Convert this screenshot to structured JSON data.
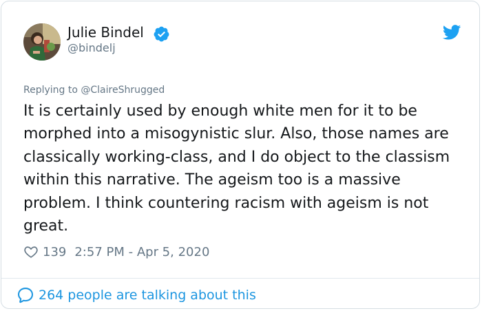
{
  "author": {
    "name": "Julie Bindel",
    "handle": "@bindelj",
    "verified": true,
    "avatar": "profile-photo"
  },
  "tweet": {
    "replying_to": "Replying to @ClaireShrugged",
    "text": "It is certainly used by enough white men for it to be morphed into a misogynistic slur. Also, those names are classically working-class, and I do object to the classism within this narrative. The ageism too is a massive problem. I think countering racism with ageism is not great.",
    "likes": "139",
    "timestamp": "2:57 PM - Apr 5, 2020"
  },
  "footer": {
    "talking": "264 people are talking about this"
  },
  "icons": {
    "brand": "twitter-bird-icon",
    "verified": "verified-badge-icon",
    "like": "heart-icon",
    "conversation": "comment-bubble-icon"
  },
  "colors": {
    "brand_blue": "#1da1f2",
    "link_blue": "#1b95e0",
    "text_primary": "#14171a",
    "text_secondary": "#657786",
    "border": "#d5dde3"
  }
}
